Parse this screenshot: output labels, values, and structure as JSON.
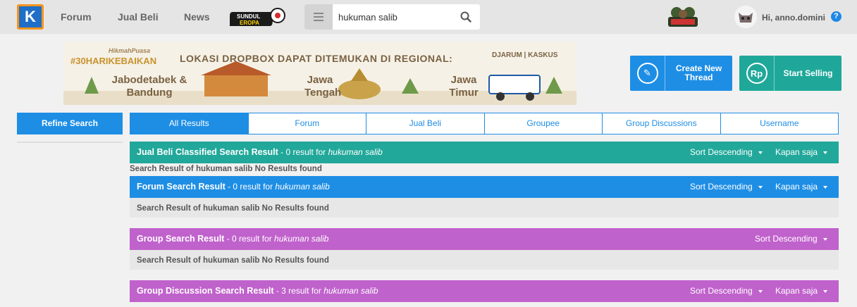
{
  "nav": {
    "links": [
      "Forum",
      "Jual Beli",
      "News"
    ],
    "promo_logo": "SUNDUL EROPA",
    "search_value": "hukuman salib",
    "greeting": "Hi, anno.domini",
    "help": "?"
  },
  "banner": {
    "hashtag": "#30HARIKEBAIKAN",
    "hikmah": "HikmahPuasa",
    "headline": "LOKASI DROPBOX DAPAT DITEMUKAN DI REGIONAL:",
    "region1": "Jabodetabek & Bandung",
    "region2": "Jawa Tengah",
    "region3": "Jawa Timur",
    "sponsor": "DJARUM | KASKUS"
  },
  "cta": {
    "create": "Create New Thread",
    "sell": "Start Selling"
  },
  "refine": "Refine Search",
  "tabs": [
    "All Results",
    "Forum",
    "Jual Beli",
    "Groupee",
    "Group Discussions",
    "Username"
  ],
  "sections": [
    {
      "title": "Jual Beli Classified Search Result",
      "count_text": " - 0 result for ",
      "query": "hukuman salib",
      "sort": "Sort Descending",
      "time": "Kapan saja",
      "message": "Search Result of hukuman salib No Results found"
    },
    {
      "title": "Forum Search Result",
      "count_text": " - 0 result for ",
      "query": "hukuman salib",
      "sort": "Sort Descending",
      "time": "Kapan saja",
      "message": "Search Result of hukuman salib No Results found"
    },
    {
      "title": "Group Search Result",
      "count_text": " - 0 result for ",
      "query": "hukuman salib",
      "sort": "Sort Descending",
      "message": "Search Result of hukuman salib No Results found"
    },
    {
      "title": "Group Discussion Search Result",
      "count_text": " - 3 result for ",
      "query": "hukuman salib",
      "sort": "Sort Descending",
      "time": "Kapan saja"
    }
  ],
  "colors": {
    "blue": "#1e8ee5",
    "teal": "#21a89a",
    "purple": "#c062cc",
    "logo_orange": "#f7941d"
  }
}
